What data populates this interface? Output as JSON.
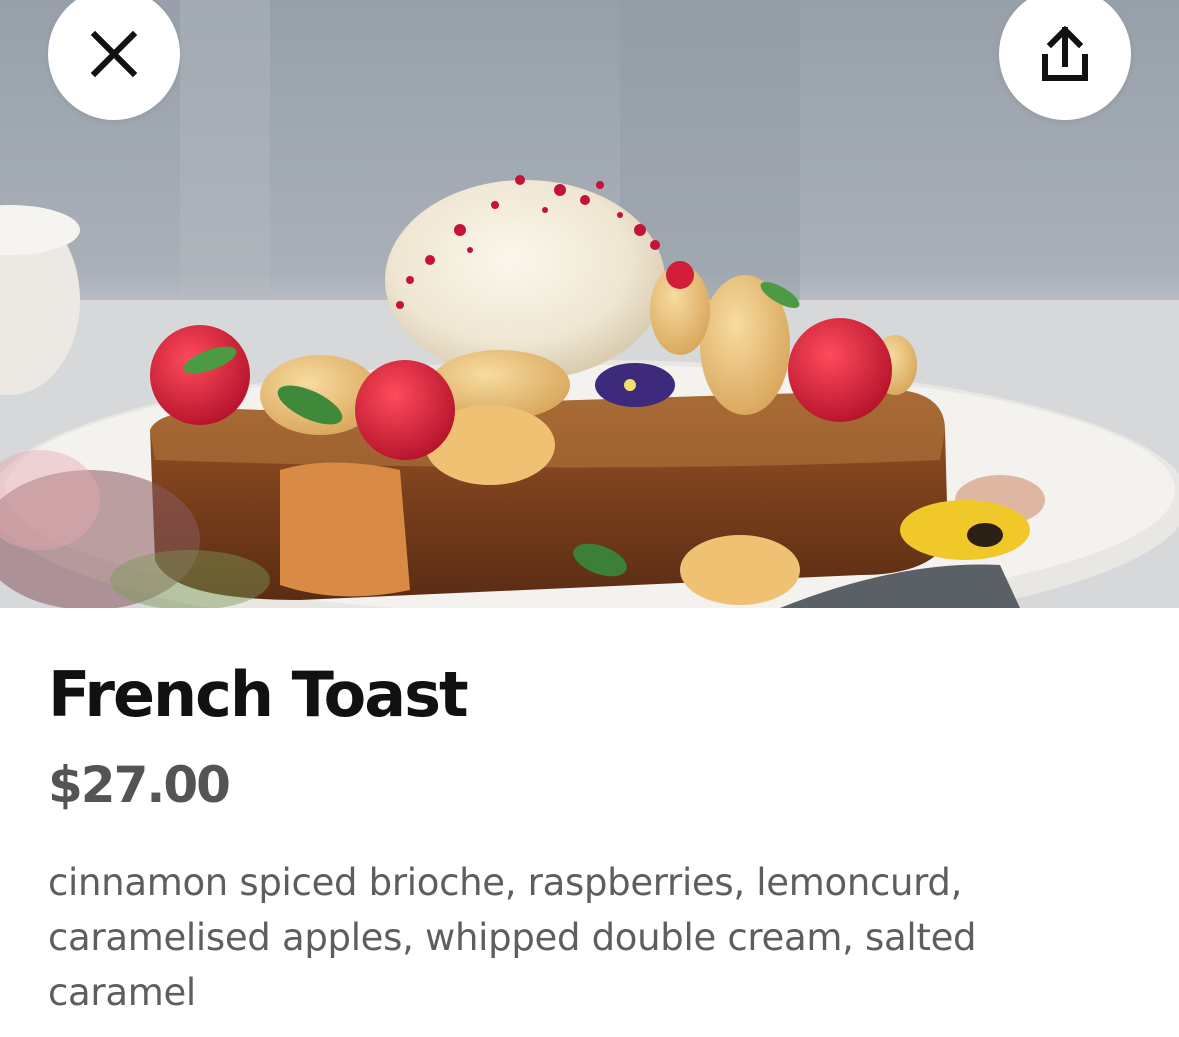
{
  "header": {
    "close_icon": "close-icon",
    "share_icon": "share-icon"
  },
  "hero": {
    "image_subject": "french-toast-photo"
  },
  "item": {
    "title": "French Toast",
    "price": "$27.00",
    "description": "cinnamon spiced brioche, raspberries, lemoncurd, caramelised apples, whipped double cream, salted caramel"
  },
  "colors": {
    "title": "#111111",
    "price": "#545454",
    "description": "#5e5e5e",
    "button_bg": "#ffffff"
  }
}
